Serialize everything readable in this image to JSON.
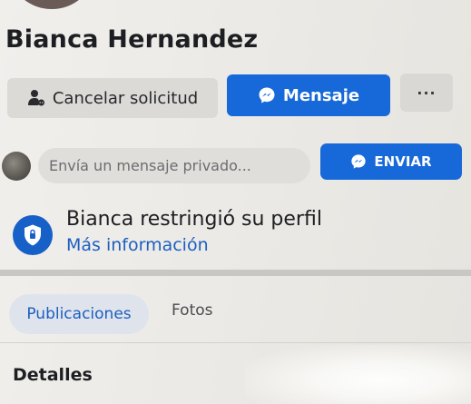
{
  "profile": {
    "name": "Bianca Hernandez"
  },
  "actions": {
    "cancel_label": "Cancelar solicitud",
    "message_label": "Mensaje",
    "more_label": "···"
  },
  "compose": {
    "placeholder": "Envía un mensaje privado...",
    "send_label": "ENVIAR"
  },
  "notice": {
    "title": "Bianca restringió su perfil",
    "link": "Más información"
  },
  "tabs": [
    {
      "label": "Publicaciones",
      "active": true
    },
    {
      "label": "Fotos",
      "active": false
    }
  ],
  "section": {
    "title": "Detalles"
  },
  "colors": {
    "primary_blue": "#1768d8",
    "link_blue": "#1b5fc0",
    "active_tab_bg": "#dfe4ec"
  },
  "icons": {
    "cancel": "user-pending-icon",
    "message": "messenger-icon",
    "send": "messenger-icon",
    "restrict": "shield-lock-icon"
  }
}
